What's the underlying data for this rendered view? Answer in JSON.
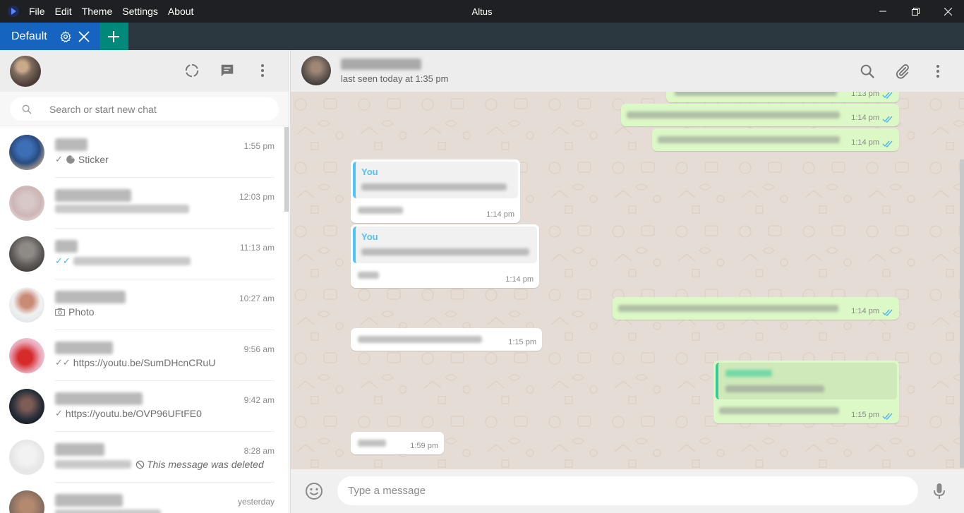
{
  "titlebar": {
    "menu": [
      "File",
      "Edit",
      "Theme",
      "Settings",
      "About"
    ],
    "title": "Altus",
    "controls": [
      "minimize-icon",
      "restore-icon",
      "close-icon"
    ]
  },
  "tabs": {
    "active": {
      "label": "Default",
      "icons": [
        "gear-icon",
        "close-icon"
      ]
    },
    "add_icon": "plus-icon",
    "colors": {
      "active_tab": "#1565c0",
      "add_tab": "#00897b",
      "bar": "#2b3840"
    }
  },
  "sidebar": {
    "header_icons": [
      "status-icon",
      "new-chat-icon",
      "menu-icon"
    ],
    "search_placeholder": "Search or start new chat",
    "chats": [
      {
        "time": "1:55 pm",
        "preview": "Sticker",
        "preview_icon": "sticker-icon",
        "tick": "single"
      },
      {
        "time": "12:03 pm",
        "preview": "",
        "tick": "none"
      },
      {
        "time": "11:13 am",
        "preview": "",
        "tick": "double-blue"
      },
      {
        "time": "10:27 am",
        "preview": "Photo",
        "preview_icon": "camera-icon",
        "tick": "none"
      },
      {
        "time": "9:56 am",
        "preview": "https://youtu.be/SumDHcnCRuU",
        "tick": "double"
      },
      {
        "time": "9:42 am",
        "preview": "https://youtu.be/OVP96UFtFE0",
        "tick": "single"
      },
      {
        "time": "8:28 am",
        "preview": "This message was deleted",
        "preview_icon": "deleted-icon",
        "tick": "none"
      },
      {
        "time": "yesterday",
        "preview": "",
        "tick": "none"
      }
    ]
  },
  "conversation": {
    "contact_status": "last seen today at 1:35 pm",
    "header_icons": [
      "search-icon",
      "attach-icon",
      "menu-icon"
    ],
    "messages": [
      {
        "dir": "out",
        "time": "1:13 pm"
      },
      {
        "dir": "out",
        "time": "1:14 pm"
      },
      {
        "dir": "out",
        "time": "1:14 pm"
      },
      {
        "dir": "in",
        "quote_name": "You",
        "time": "1:14 pm"
      },
      {
        "dir": "in",
        "quote_name": "You",
        "time": "1:14 pm"
      },
      {
        "dir": "out",
        "time": "1:14 pm"
      },
      {
        "dir": "in",
        "time": "1:15 pm"
      },
      {
        "dir": "out",
        "time": "1:15 pm"
      },
      {
        "dir": "in",
        "time": "1:59 pm"
      }
    ],
    "composer_placeholder": "Type a message",
    "composer_icons": [
      "emoji-icon",
      "mic-icon"
    ]
  }
}
